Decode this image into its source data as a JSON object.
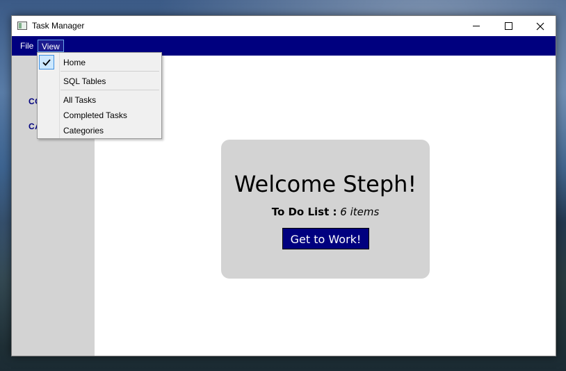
{
  "window": {
    "title": "Task Manager",
    "controls": {
      "minimize": "minimize-icon",
      "maximize": "maximize-icon",
      "close": "close-icon"
    }
  },
  "menubar": {
    "items": [
      {
        "label": "File"
      },
      {
        "label": "View"
      }
    ],
    "background": "#00007f"
  },
  "view_menu": {
    "items": [
      {
        "label": "Home",
        "checked": true
      },
      {
        "label": "SQL Tables"
      },
      {
        "label": "All Tasks"
      },
      {
        "label": "Completed Tasks"
      },
      {
        "label": "Categories"
      }
    ]
  },
  "sidebar": {
    "items": [
      {
        "label": "CO"
      },
      {
        "label": "CA"
      }
    ]
  },
  "welcome_card": {
    "heading": "Welcome Steph!",
    "todo_label": "To Do List :",
    "todo_count": "6 items",
    "button_label": "Get to Work!"
  },
  "colors": {
    "accent": "#00007f",
    "panel": "#d3d3d3",
    "checked_highlight": "#cce8ff"
  }
}
